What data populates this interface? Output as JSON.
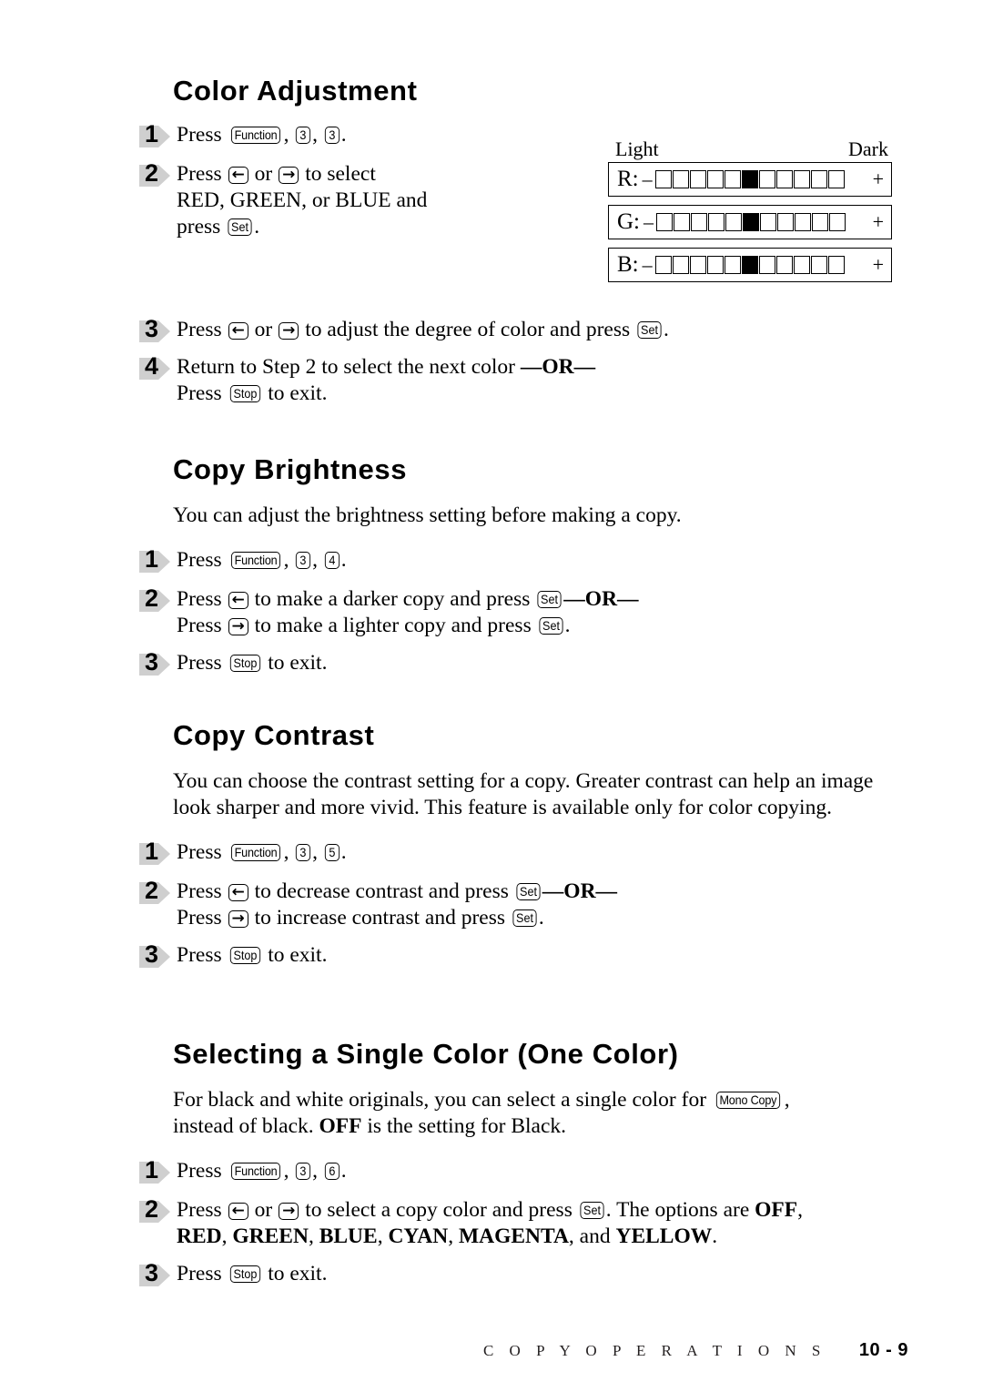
{
  "document": {
    "footer_title": "C O P Y   O P E R A T I O N S",
    "footer_page": "10 - 9"
  },
  "keys": {
    "function": "Function",
    "set": "Set",
    "stop": "Stop",
    "mono_copy": "Mono Copy",
    "left_arrow": "←",
    "right_arrow": "→",
    "digit_3": "3",
    "digit_4": "4",
    "digit_5": "5",
    "digit_6": "6"
  },
  "sections": [
    {
      "id": "color-adjustment",
      "heading": "Color Adjustment",
      "steps": [
        {
          "number": "1",
          "parts": [
            {
              "t": "text",
              "v": "Press "
            },
            {
              "t": "key",
              "v": "Function",
              "style": "wide"
            },
            {
              "t": "text",
              "v": ", "
            },
            {
              "t": "key",
              "v": "3",
              "style": "digit"
            },
            {
              "t": "text",
              "v": ", "
            },
            {
              "t": "key",
              "v": "3",
              "style": "digit"
            },
            {
              "t": "text",
              "v": "."
            }
          ]
        },
        {
          "number": "2",
          "parts": [
            {
              "t": "text",
              "v": "Press "
            },
            {
              "t": "key",
              "v": "←",
              "style": "arrow"
            },
            {
              "t": "text",
              "v": " or "
            },
            {
              "t": "key",
              "v": "→",
              "style": "arrow"
            },
            {
              "t": "text",
              "v": " to select"
            },
            {
              "t": "br"
            },
            {
              "t": "text",
              "v": "RED, GREEN, or BLUE and"
            },
            {
              "t": "br"
            },
            {
              "t": "text",
              "v": "press "
            },
            {
              "t": "key",
              "v": "Set",
              "style": ""
            },
            {
              "t": "text",
              "v": "."
            }
          ]
        },
        {
          "number": "3",
          "parts": [
            {
              "t": "text",
              "v": "Press "
            },
            {
              "t": "key",
              "v": "←",
              "style": "arrow"
            },
            {
              "t": "text",
              "v": " or "
            },
            {
              "t": "key",
              "v": "→",
              "style": "arrow"
            },
            {
              "t": "text",
              "v": " to adjust the degree of color and press "
            },
            {
              "t": "key",
              "v": "Set",
              "style": ""
            },
            {
              "t": "text",
              "v": "."
            }
          ]
        },
        {
          "number": "4",
          "parts": [
            {
              "t": "text",
              "v": "Return to Step 2 to select the next color "
            },
            {
              "t": "bold",
              "v": "—OR—"
            },
            {
              "t": "br"
            },
            {
              "t": "text",
              "v": "Press "
            },
            {
              "t": "key",
              "v": "Stop",
              "style": ""
            },
            {
              "t": "text",
              "v": " to exit."
            }
          ]
        }
      ]
    },
    {
      "id": "copy-brightness",
      "heading": "Copy Brightness",
      "intro": "You can adjust the brightness setting before making a copy.",
      "steps": [
        {
          "number": "1",
          "parts": [
            {
              "t": "text",
              "v": "Press "
            },
            {
              "t": "key",
              "v": "Function",
              "style": "wide"
            },
            {
              "t": "text",
              "v": ", "
            },
            {
              "t": "key",
              "v": "3",
              "style": "digit"
            },
            {
              "t": "text",
              "v": ", "
            },
            {
              "t": "key",
              "v": "4",
              "style": "digit"
            },
            {
              "t": "text",
              "v": "."
            }
          ]
        },
        {
          "number": "2",
          "parts": [
            {
              "t": "text",
              "v": "Press "
            },
            {
              "t": "key",
              "v": "←",
              "style": "arrow"
            },
            {
              "t": "text",
              "v": " to make a darker copy and press "
            },
            {
              "t": "key",
              "v": "Set",
              "style": ""
            },
            {
              "t": "bold",
              "v": "—OR—"
            },
            {
              "t": "br"
            },
            {
              "t": "text",
              "v": "Press "
            },
            {
              "t": "key",
              "v": "→",
              "style": "arrow"
            },
            {
              "t": "text",
              "v": " to make a lighter copy and press "
            },
            {
              "t": "key",
              "v": "Set",
              "style": ""
            },
            {
              "t": "text",
              "v": "."
            }
          ]
        },
        {
          "number": "3",
          "parts": [
            {
              "t": "text",
              "v": "Press "
            },
            {
              "t": "key",
              "v": "Stop",
              "style": ""
            },
            {
              "t": "text",
              "v": " to exit."
            }
          ]
        }
      ]
    },
    {
      "id": "copy-contrast",
      "heading": "Copy Contrast",
      "intro": "You can choose the contrast setting for a copy. Greater contrast can help an image look sharper and more vivid.  This feature is available only for color copying.",
      "steps": [
        {
          "number": "1",
          "parts": [
            {
              "t": "text",
              "v": "Press "
            },
            {
              "t": "key",
              "v": "Function",
              "style": "wide"
            },
            {
              "t": "text",
              "v": ", "
            },
            {
              "t": "key",
              "v": "3",
              "style": "digit"
            },
            {
              "t": "text",
              "v": ", "
            },
            {
              "t": "key",
              "v": "5",
              "style": "digit"
            },
            {
              "t": "text",
              "v": "."
            }
          ]
        },
        {
          "number": "2",
          "parts": [
            {
              "t": "text",
              "v": "Press "
            },
            {
              "t": "key",
              "v": "←",
              "style": "arrow"
            },
            {
              "t": "text",
              "v": " to decrease contrast and press "
            },
            {
              "t": "key",
              "v": "Set",
              "style": ""
            },
            {
              "t": "bold",
              "v": "—OR—"
            },
            {
              "t": "br"
            },
            {
              "t": "text",
              "v": "Press "
            },
            {
              "t": "key",
              "v": "→",
              "style": "arrow"
            },
            {
              "t": "text",
              "v": " to increase contrast and press "
            },
            {
              "t": "key",
              "v": "Set",
              "style": ""
            },
            {
              "t": "text",
              "v": "."
            }
          ]
        },
        {
          "number": "3",
          "parts": [
            {
              "t": "text",
              "v": "Press "
            },
            {
              "t": "key",
              "v": "Stop",
              "style": ""
            },
            {
              "t": "text",
              "v": " to exit."
            }
          ]
        }
      ]
    },
    {
      "id": "single-color",
      "heading": "Selecting a Single Color (One Color)",
      "intro_parts": [
        {
          "t": "text",
          "v": "For black and white originals, you can select a single color for "
        },
        {
          "t": "key",
          "v": "Mono Copy",
          "style": "wide"
        },
        {
          "t": "text",
          "v": ","
        },
        {
          "t": "br"
        },
        {
          "t": "text",
          "v": "instead of black. "
        },
        {
          "t": "bold",
          "v": "OFF"
        },
        {
          "t": "text",
          "v": " is the setting for Black."
        }
      ],
      "steps": [
        {
          "number": "1",
          "parts": [
            {
              "t": "text",
              "v": "Press "
            },
            {
              "t": "key",
              "v": "Function",
              "style": "wide"
            },
            {
              "t": "text",
              "v": ", "
            },
            {
              "t": "key",
              "v": "3",
              "style": "digit"
            },
            {
              "t": "text",
              "v": ", "
            },
            {
              "t": "key",
              "v": "6",
              "style": "digit"
            },
            {
              "t": "text",
              "v": "."
            }
          ]
        },
        {
          "number": "2",
          "parts": [
            {
              "t": "text",
              "v": "Press "
            },
            {
              "t": "key",
              "v": "←",
              "style": "arrow"
            },
            {
              "t": "text",
              "v": " or "
            },
            {
              "t": "key",
              "v": "→",
              "style": "arrow"
            },
            {
              "t": "text",
              "v": " to select a copy color and press "
            },
            {
              "t": "key",
              "v": "Set",
              "style": ""
            },
            {
              "t": "text",
              "v": ". The options are "
            },
            {
              "t": "bold",
              "v": "OFF"
            },
            {
              "t": "text",
              "v": ","
            },
            {
              "t": "br"
            },
            {
              "t": "bold",
              "v": "RED"
            },
            {
              "t": "text",
              "v": ", "
            },
            {
              "t": "bold",
              "v": "GREEN"
            },
            {
              "t": "text",
              "v": ", "
            },
            {
              "t": "bold",
              "v": "BLUE"
            },
            {
              "t": "text",
              "v": ", "
            },
            {
              "t": "bold",
              "v": "CYAN"
            },
            {
              "t": "text",
              "v": ", "
            },
            {
              "t": "bold",
              "v": "MAGENTA"
            },
            {
              "t": "text",
              "v": ", and "
            },
            {
              "t": "bold",
              "v": "YELLOW"
            },
            {
              "t": "text",
              "v": "."
            }
          ]
        },
        {
          "number": "3",
          "parts": [
            {
              "t": "text",
              "v": "Press "
            },
            {
              "t": "key",
              "v": "Stop",
              "style": ""
            },
            {
              "t": "text",
              "v": " to exit."
            }
          ]
        }
      ]
    }
  ],
  "lcd_panel": {
    "label_light": "Light",
    "label_dark": "Dark",
    "minus": "–",
    "plus": "+",
    "cell_count": 11,
    "selected_index": 6,
    "rows": [
      {
        "label": "R:"
      },
      {
        "label": "G:"
      },
      {
        "label": "B:"
      }
    ]
  }
}
